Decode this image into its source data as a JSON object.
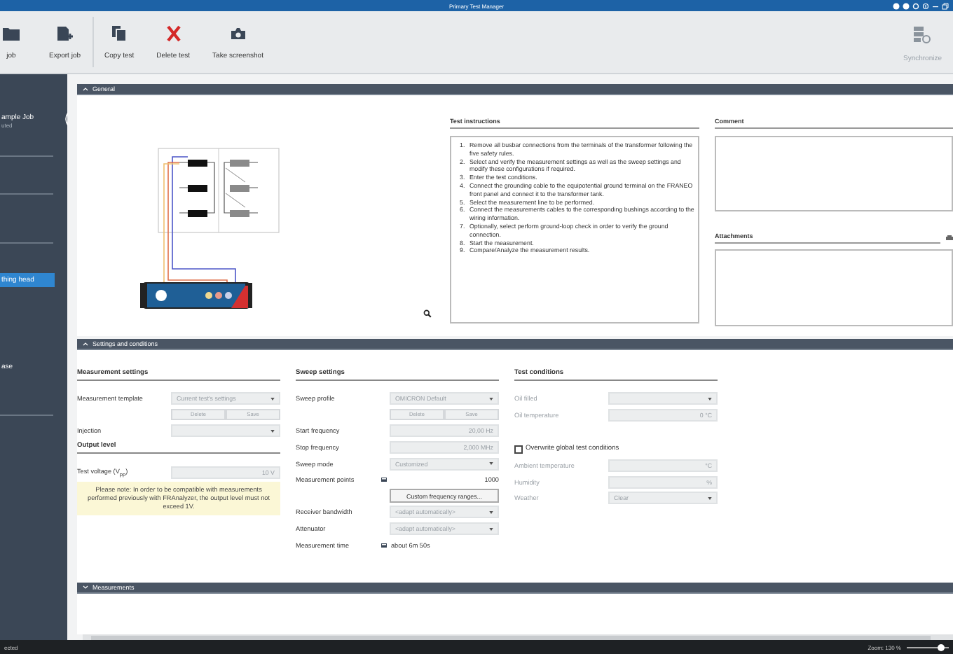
{
  "window": {
    "title": "Primary Test Manager"
  },
  "toolbar": [
    {
      "kind": "open",
      "label": "job",
      "disabled": false
    },
    {
      "kind": "export",
      "label": "Export job",
      "disabled": false
    },
    {
      "kind": "copy",
      "label": "Copy test",
      "disabled": false
    },
    {
      "kind": "delete",
      "label": "Delete test",
      "disabled": false
    },
    {
      "kind": "camera",
      "label": "Take screenshot",
      "disabled": false
    },
    {
      "kind": "sync",
      "label": "Synchronize",
      "disabled": true
    }
  ],
  "sidebar": {
    "items": [
      {
        "title": "ample Job",
        "subtitle": "uted",
        "selected": false
      },
      {
        "title": "thing head",
        "selected": true
      },
      {
        "title": "ase",
        "selected": false
      }
    ]
  },
  "general": {
    "title": "General",
    "expanded": true,
    "instructions_title": "Test instructions",
    "instructions": [
      {
        "number": "1.",
        "text": "Remove all busbar connections from the terminals of the transformer following the five safety rules."
      },
      {
        "number": "2.",
        "text": "Select and verify the measurement settings as well as the sweep settings and modify these configurations if required."
      },
      {
        "number": "3.",
        "text": "Enter the test conditions."
      },
      {
        "number": "4.",
        "text": "Connect the grounding cable to the equipotential ground terminal on the FRANEO front panel and connect it to the transformer tank."
      },
      {
        "number": "5.",
        "text": "Select the measurement line to be performed."
      },
      {
        "number": "6.",
        "text": "Connect the measurements cables to the corresponding bushings according to the wiring information."
      },
      {
        "number": "7.",
        "text": "Optionally, select perform ground-loop check in order to verify the ground connection."
      },
      {
        "number": "8.",
        "text": "Start the measurement."
      },
      {
        "number": "9.",
        "text": "Compare/Analyze the measurement results."
      }
    ],
    "comment_title": "Comment",
    "attachments_title": "Attachments"
  },
  "settings": {
    "title": "Settings and conditions",
    "expanded": true,
    "columns": [
      {
        "title": "Measurement settings",
        "rows": [
          {
            "kind": "select",
            "label": "Measurement template",
            "value": "Current test's settings",
            "disabled": false
          },
          {
            "kind": "buttons",
            "buttons": [
              "Delete",
              "Save"
            ],
            "disabled": true
          },
          {
            "kind": "select",
            "label": "Injection",
            "disabled": false
          },
          {
            "kind": "heading",
            "title": "Output level"
          },
          {
            "kind": "number",
            "label": "Test voltage (V$_{pp}$)",
            "value": "10 V",
            "disabled": false
          },
          {
            "kind": "note",
            "text": "Please note: In order to be compatible with measurements performed previously with FRAnalyzer, the output level must not exceed 1V."
          }
        ]
      },
      {
        "title": "Sweep settings",
        "rows": [
          {
            "kind": "select",
            "label": "Sweep profile",
            "value": "OMICRON Default",
            "disabled": false
          },
          {
            "kind": "buttons",
            "buttons": [
              "Delete",
              "Save"
            ],
            "disabled": true
          },
          {
            "kind": "number",
            "label": "Start frequency",
            "value": "20,00 Hz",
            "disabled": false
          },
          {
            "kind": "number",
            "label": "Stop frequency",
            "value": "2,000 MHz",
            "disabled": false
          },
          {
            "kind": "select",
            "label": "Sweep mode",
            "value": "Customized",
            "disabled": false
          },
          {
            "kind": "count",
            "label": "Measurement points",
            "value": "1000",
            "disabled": false
          },
          {
            "kind": "button",
            "text": "Custom frequency ranges...",
            "disabled": false
          },
          {
            "kind": "select",
            "label": "Receiver bandwidth",
            "value": "<adapt automatically>",
            "disabled": false
          },
          {
            "kind": "select",
            "label": "Attenuator",
            "value": "<adapt automatically>",
            "disabled": false
          },
          {
            "kind": "readout",
            "label": "Measurement time",
            "value": "about 6m 50s",
            "disabled": false
          }
        ]
      },
      {
        "title": "Test conditions",
        "rows": [
          {
            "kind": "select",
            "label": "Oil filled",
            "disabled": true
          },
          {
            "kind": "number",
            "label": "Oil temperature",
            "value": "0 °C",
            "disabled": true
          },
          {
            "kind": "checkbox",
            "label": "Overwrite global test conditions",
            "checked": false,
            "disabled": false
          },
          {
            "kind": "number",
            "label": "Ambient temperature",
            "value": "°C",
            "disabled": true
          },
          {
            "kind": "number",
            "label": "Humidity",
            "value": "%",
            "disabled": true
          },
          {
            "kind": "select",
            "label": "Weather",
            "value": "Clear",
            "disabled": true
          }
        ]
      }
    ]
  },
  "measurements": {
    "title": "Measurements",
    "expanded": false
  },
  "status_bar": {
    "text": "ected",
    "zoom_label": "Zoom: 130 %",
    "zoom": {
      "level": 0.8
    }
  }
}
